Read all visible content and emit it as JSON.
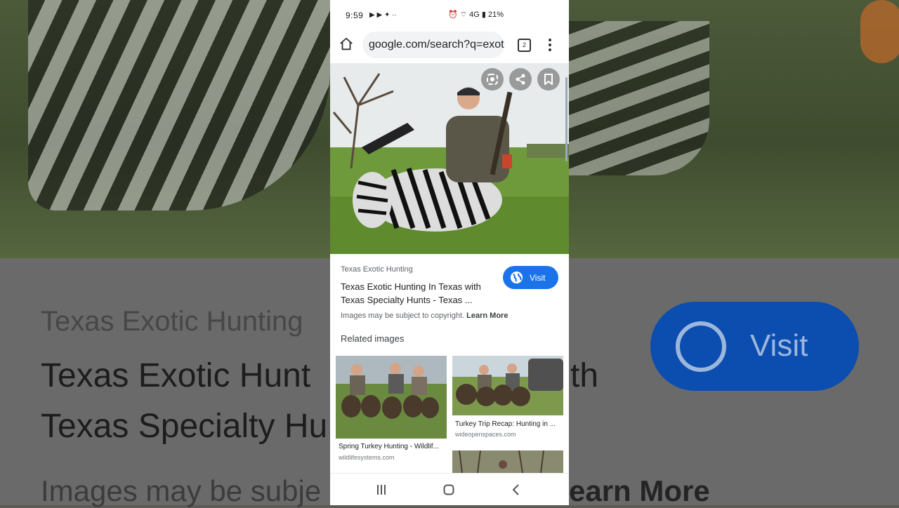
{
  "background": {
    "source": "Texas Exotic Hunting",
    "title_line1": "Texas Exotic Hunt",
    "title_line1_right": "th",
    "title_line2": "Texas Specialty Hu",
    "copyright": "Images may be subje",
    "learn_more": "earn More",
    "visit_label": "Visit"
  },
  "status_bar": {
    "time": "9:59",
    "left_icons": "▶ ▶ ✦ ··",
    "right_icons": "⏰ ⌔ 4G ▮ 21%"
  },
  "browser": {
    "url": "google.com/search?q=exotic",
    "tab_count": "2"
  },
  "result": {
    "source": "Texas Exotic Hunting",
    "title": "Texas Exotic Hunting In Texas with Texas Specialty Hunts - Texas ...",
    "visit_label": "Visit",
    "copyright_text": "Images may be subject to copyright.",
    "learn_more": "Learn More"
  },
  "related": {
    "heading": "Related images",
    "items": [
      {
        "caption": "Spring Turkey Hunting - Wildlif...",
        "domain": "wildlifesystems.com"
      },
      {
        "caption": "Turkey Trip Recap: Hunting in ...",
        "domain": "wideopenspaces.com"
      }
    ]
  },
  "colors": {
    "accent": "#1a73e8"
  }
}
